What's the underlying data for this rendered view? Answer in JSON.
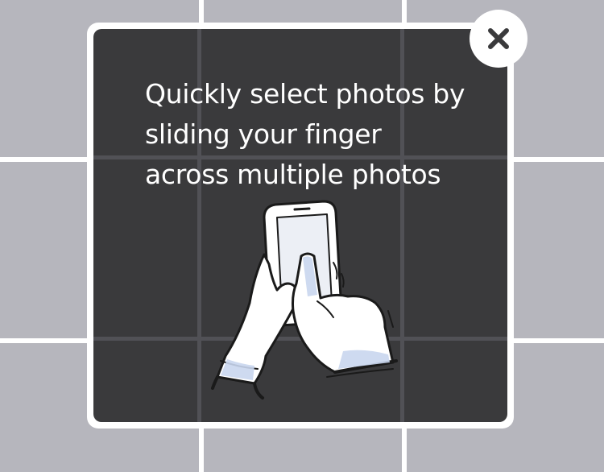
{
  "onboarding": {
    "message_lines": [
      "Quickly select photos by",
      "sliding your finger",
      "across multiple photos"
    ],
    "close_icon": "close-icon"
  },
  "colors": {
    "grid_cell": "#b6b6bd",
    "panel": "#3a3a3c",
    "text": "#ffffff",
    "close_glyph": "#3a3a3c"
  }
}
